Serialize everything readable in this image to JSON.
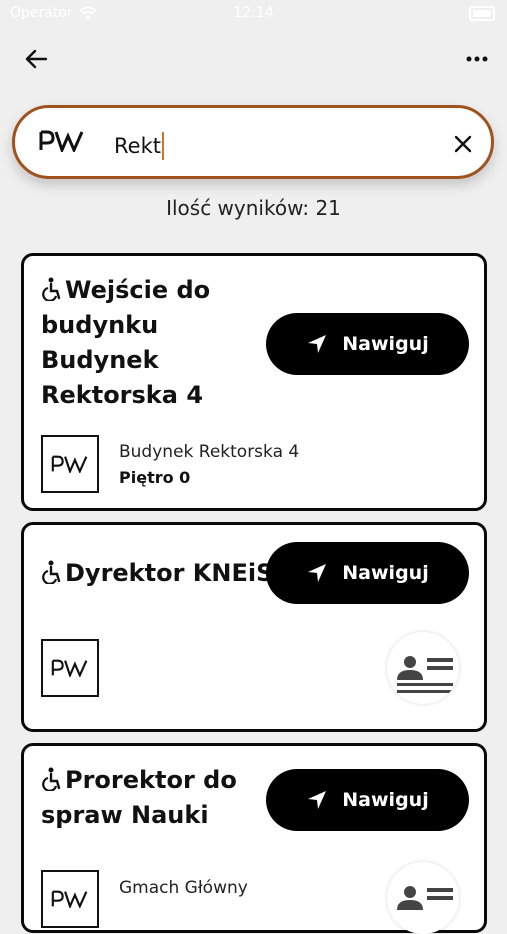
{
  "status_bar": {
    "carrier": "Operator",
    "time": "12:14"
  },
  "header": {
    "back_icon": "arrow-left-icon",
    "more_icon": "more-horizontal-icon"
  },
  "search": {
    "logo_text": "PW",
    "query": "Rekt",
    "clear_icon": "close-icon"
  },
  "results": {
    "count_label": "Ilość wyników: 21",
    "items": [
      {
        "title_lines": [
          "Wejście do",
          "budynku",
          "Budynek",
          "Rektorska 4"
        ],
        "accessible": true,
        "button_label": "Nawiguj",
        "logo_text": "PW",
        "location_name": "Budynek Rektorska 4",
        "floor": "Piętro 0"
      },
      {
        "title_lines": [
          "Dyrektor KNEiS"
        ],
        "accessible": true,
        "button_label": "Nawiguj",
        "logo_text": "PW"
      },
      {
        "title_lines": [
          "Prorektor do",
          "spraw Nauki"
        ],
        "accessible": true,
        "button_label": "Nawiguj",
        "logo_text": "PW",
        "location_name": "Gmach Główny"
      }
    ]
  },
  "colors": {
    "accent": "#a0521d",
    "caret": "#d0742a",
    "button": "#000000",
    "background": "#efefef"
  }
}
